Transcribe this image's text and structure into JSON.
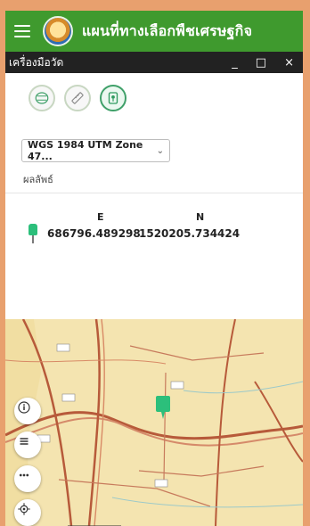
{
  "topbar": {
    "title": "แผนที่ทางเลือกพืชเศรษฐกิจ",
    "menu_icon": "hamburger-icon",
    "logo_icon": "app-logo"
  },
  "panel": {
    "title": "เครื่องมือวัด",
    "minimize_label": "_",
    "maximize_label": "□",
    "close_label": "×"
  },
  "tools": [
    {
      "name": "measure-area",
      "icon": "polygon-area-icon"
    },
    {
      "name": "measure-distance",
      "icon": "ruler-icon"
    },
    {
      "name": "measure-location",
      "icon": "location-pin-icon",
      "active": true
    }
  ],
  "projection": {
    "selected": "WGS 1984 UTM Zone 47...",
    "chevron": "⌄"
  },
  "result": {
    "label": "ผลลัพธ์",
    "columns": {
      "e": "E",
      "n": "N"
    },
    "values": {
      "e": "686796.489298",
      "n": "1520205.734424"
    }
  },
  "map_controls": [
    {
      "name": "info",
      "glyph": "ⓘ"
    },
    {
      "name": "layers",
      "glyph": "≡"
    },
    {
      "name": "more",
      "glyph": "•••"
    },
    {
      "name": "locate",
      "glyph": "◎"
    }
  ],
  "colors": {
    "topbar": "#3f9a2e",
    "frame": "#e8a06e",
    "pin": "#2cbf7b"
  }
}
